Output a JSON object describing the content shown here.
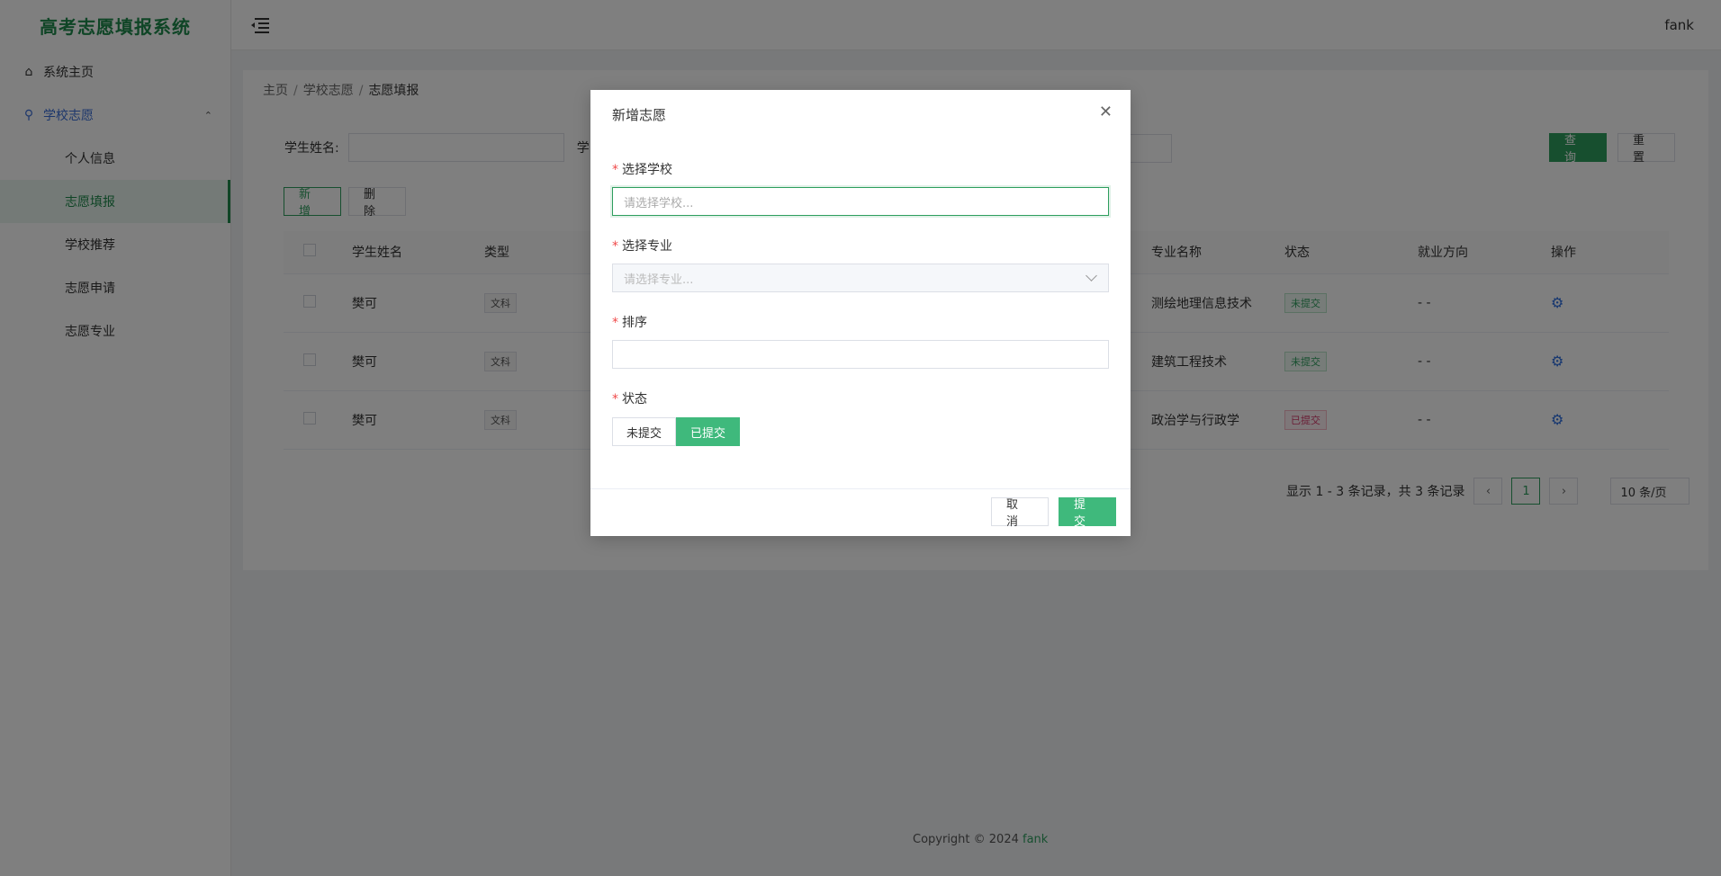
{
  "app": {
    "title": "高考志愿填报系统",
    "user": "fank"
  },
  "sidebar": {
    "items": [
      {
        "label": "系统主页",
        "icon": "home-icon"
      },
      {
        "label": "学校志愿",
        "icon": "paperclip-icon"
      }
    ],
    "sub_items": [
      "个人信息",
      "志愿填报",
      "学校推荐",
      "志愿申请",
      "志愿专业"
    ]
  },
  "breadcrumb": [
    "主页",
    "学校志愿",
    "志愿填报"
  ],
  "search": {
    "label": "学生姓名:",
    "label2_prefix": "学"
  },
  "toolbar": {
    "query": "查 询",
    "reset": "重 置",
    "add": "新 增",
    "delete": "删 除"
  },
  "table": {
    "columns": [
      "学生姓名",
      "类型",
      "专业名称",
      "状态",
      "就业方向",
      "操作"
    ],
    "rows": [
      {
        "name": "樊可",
        "type": "文科",
        "major": "测绘地理信息技术",
        "status": "未提交",
        "career": "- -"
      },
      {
        "name": "樊可",
        "type": "文科",
        "major": "建筑工程技术",
        "status": "未提交",
        "career": "- -"
      },
      {
        "name": "樊可",
        "type": "文科",
        "major": "政治学与行政学",
        "status": "已提交",
        "career": "- -"
      }
    ]
  },
  "pagination": {
    "summary": "显示 1 - 3 条记录，共 3 条记录",
    "current": "1",
    "page_size": "10 条/页"
  },
  "footer": {
    "copyright": "Copyright © 2024",
    "brand": "fank"
  },
  "modal": {
    "title": "新增志愿",
    "fields": {
      "school_label": "选择学校",
      "school_placeholder": "请选择学校...",
      "major_label": "选择专业",
      "major_placeholder": "请选择专业...",
      "order_label": "排序",
      "status_label": "状态"
    },
    "status_options": [
      "未提交",
      "已提交"
    ],
    "status_selected": "已提交",
    "cancel": "取 消",
    "submit": "提 交"
  },
  "colors": {
    "accent": "#2e9e5e",
    "submit": "#3fb97c",
    "link": "#3b6fd8"
  }
}
